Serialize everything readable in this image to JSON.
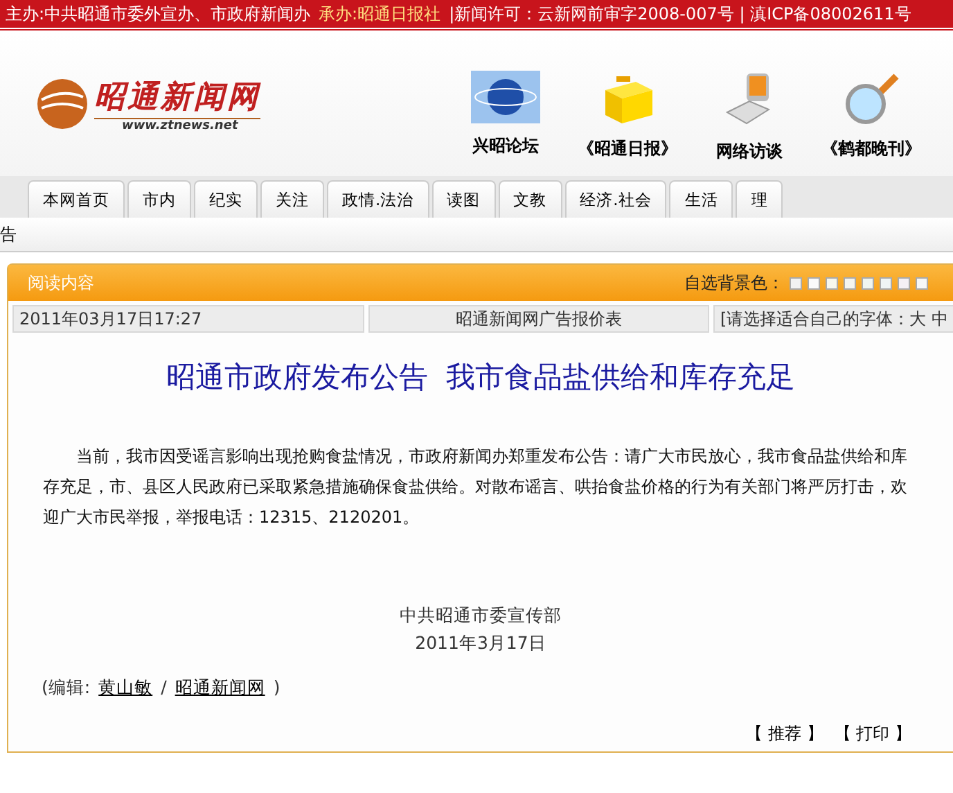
{
  "top_bar": {
    "host": "主办:中共昭通市委外宣办、市政府新闻办",
    "organizer": "承办:昭通日报社",
    "license": "|新闻许可：云新网前审字2008-007号 | 滇ICP备08002611号"
  },
  "logo": {
    "name": "昭通新闻网",
    "url": "www.ztnews.net"
  },
  "shortcuts": [
    {
      "label": "兴昭论坛",
      "kind": "globe"
    },
    {
      "label": "《昭通日报》",
      "kind": "box"
    },
    {
      "label": "网络访谈",
      "kind": "phone"
    },
    {
      "label": "《鹤都晚刊》",
      "kind": "magnifier"
    }
  ],
  "nav_tabs": [
    {
      "label": "本网首页"
    },
    {
      "label": "市内"
    },
    {
      "label": "纪实"
    },
    {
      "label": "关注"
    },
    {
      "label": "政情.法治"
    },
    {
      "label": "读图"
    },
    {
      "label": "文教"
    },
    {
      "label": "经济.社会"
    },
    {
      "label": "生活"
    },
    {
      "label": "理"
    }
  ],
  "ticker": "告",
  "panel": {
    "title": "阅读内容",
    "background_label": "自选背景色：",
    "swatches": [
      {
        "color": "#f2f2f2"
      },
      {
        "color": "#fafafa"
      },
      {
        "color": "#f7f7ee"
      },
      {
        "color": "#f5f5f0"
      },
      {
        "color": "#f0f5f0"
      },
      {
        "color": "#f0f5f5"
      },
      {
        "color": "#f5f0f5"
      },
      {
        "color": "#f7f7f7"
      }
    ],
    "date": "2011年03月17日17:27",
    "ad_link": "昭通新闻网广告报价表",
    "font_prompt": "[请选择适合自己的字体：大 中",
    "headline": "昭通市政府发布公告  我市食品盐供给和库存充足",
    "body": "当前，我市因受谣言影响出现抢购食盐情况，市政府新闻办郑重发布公告：请广大市民放心，我市食品盐供给和库存充足，市、县区人民政府已采取紧急措施确保食盐供给。对散布谣言、哄抬食盐价格的行为有关部门将严厉打击，欢迎广大市民举报，举报电话：12315、2120201。",
    "signature": "中共昭通市委宣传部",
    "sign_date": "2011年3月17日",
    "editor_label": "(编辑:",
    "editor": "黄山敏",
    "separator": "/",
    "source": "昭通新闻网",
    "close_paren": ")",
    "actions": [
      {
        "label": "推荐"
      },
      {
        "label": "打印"
      }
    ],
    "bracket_open": "【",
    "bracket_close": "】"
  }
}
